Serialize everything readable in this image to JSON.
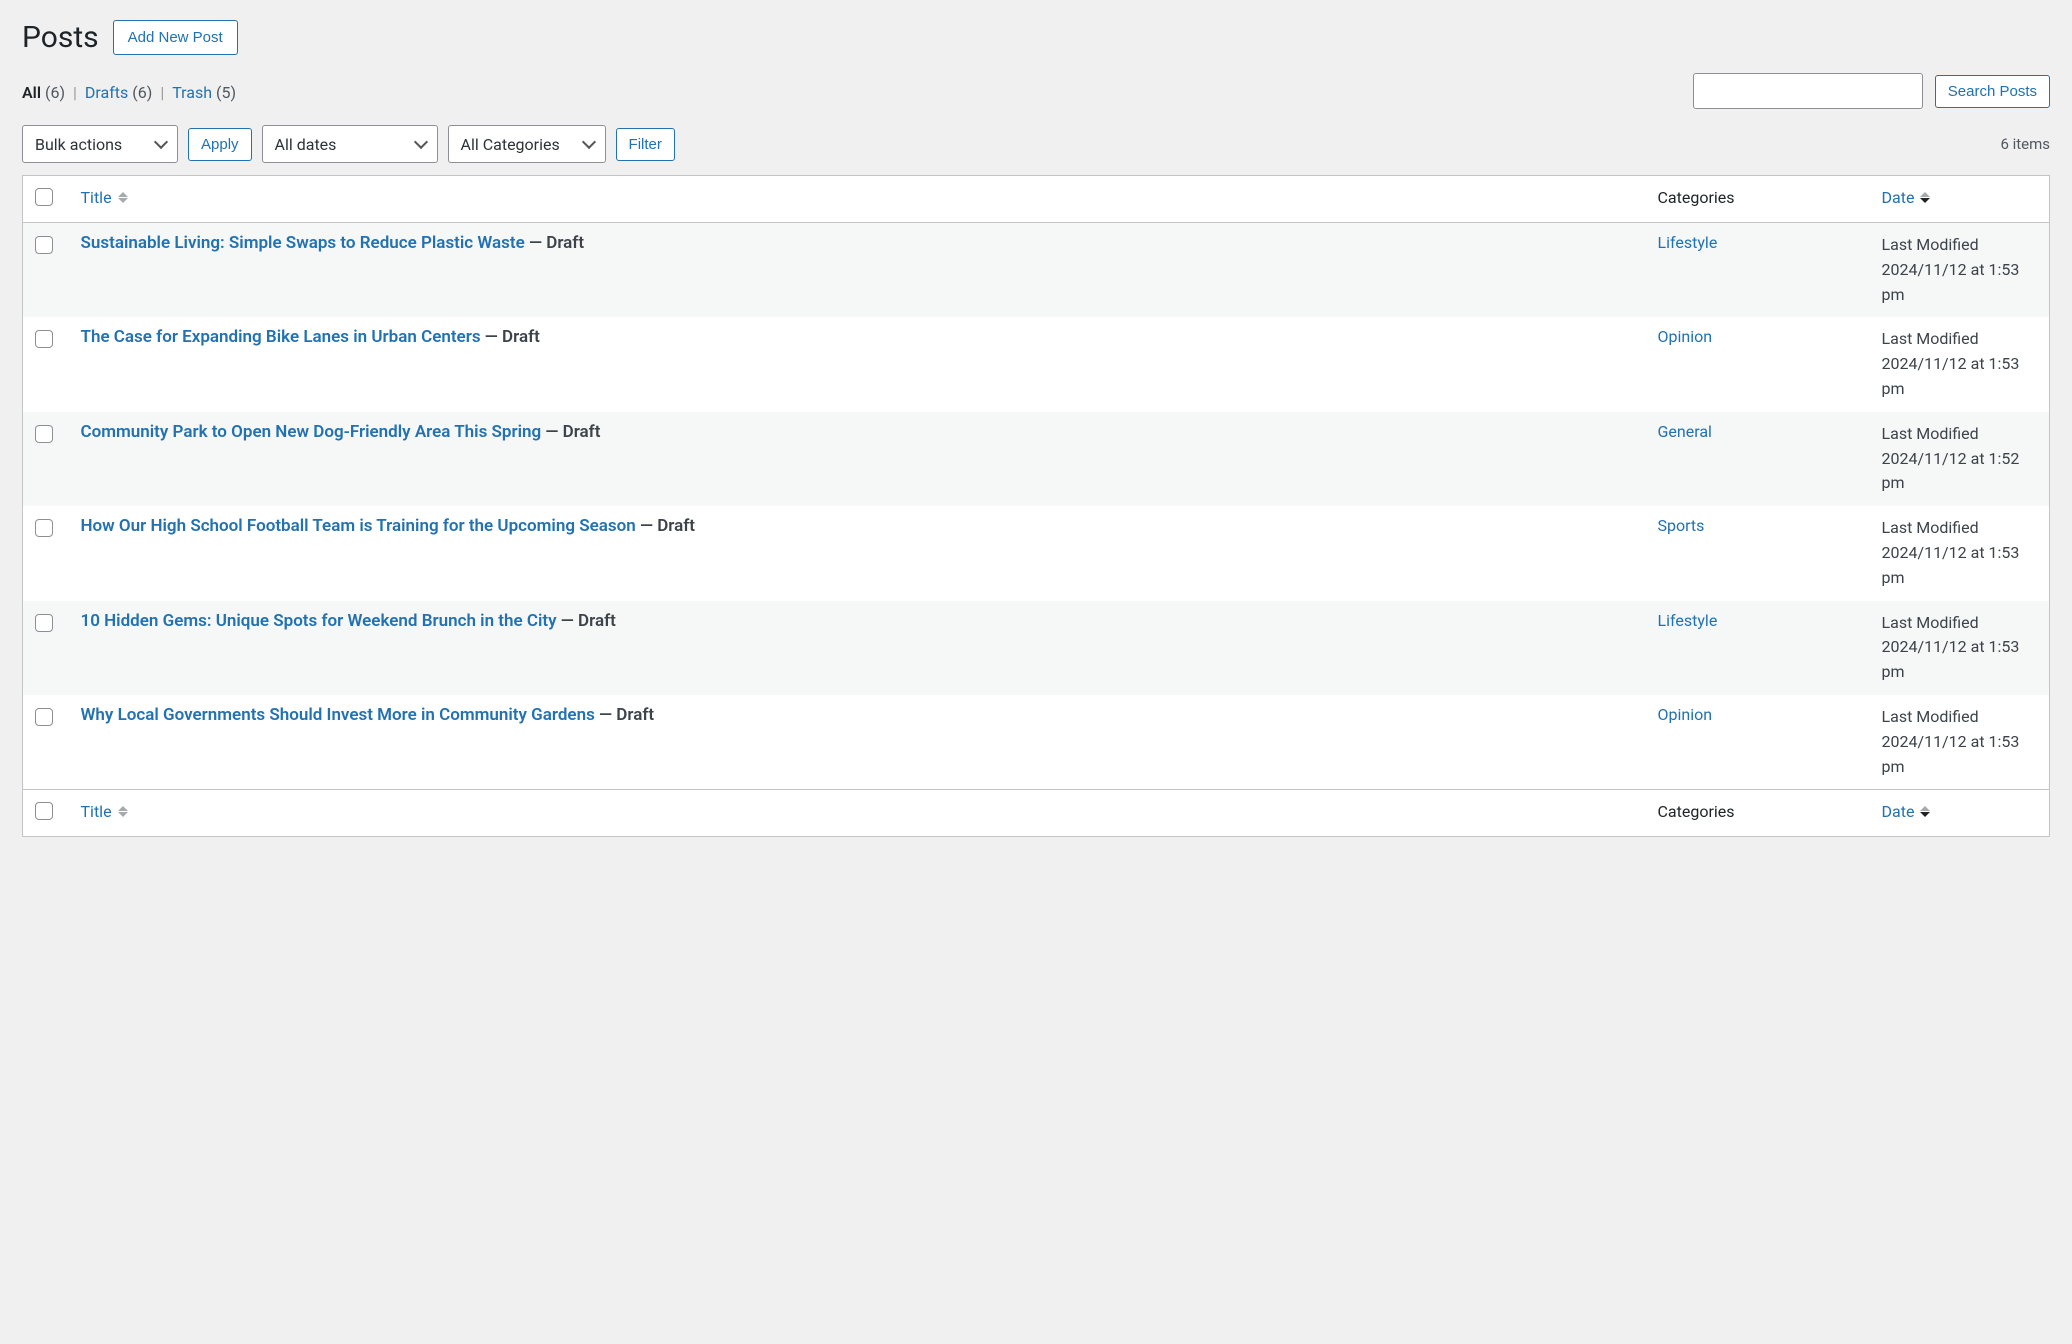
{
  "header": {
    "title": "Posts",
    "add_new_label": "Add New Post"
  },
  "filters_nav": {
    "all_label": "All",
    "all_count": "(6)",
    "drafts_label": "Drafts",
    "drafts_count": "(6)",
    "trash_label": "Trash",
    "trash_count": "(5)"
  },
  "search": {
    "button_label": "Search Posts"
  },
  "toolbar": {
    "bulk_actions_label": "Bulk actions",
    "apply_label": "Apply",
    "all_dates_label": "All dates",
    "all_categories_label": "All Categories",
    "filter_label": "Filter",
    "item_count": "6 items"
  },
  "columns": {
    "title": "Title",
    "categories": "Categories",
    "date": "Date"
  },
  "status_labels": {
    "draft_suffix": " — Draft"
  },
  "posts": [
    {
      "title": "Sustainable Living: Simple Swaps to Reduce Plastic Waste",
      "category": "Lifestyle",
      "date_prefix": "Last Modified",
      "date_line": "2024/11/12 at 1:53 pm"
    },
    {
      "title": "The Case for Expanding Bike Lanes in Urban Centers",
      "category": "Opinion",
      "date_prefix": "Last Modified",
      "date_line": "2024/11/12 at 1:53 pm"
    },
    {
      "title": "Community Park to Open New Dog-Friendly Area This Spring",
      "category": "General",
      "date_prefix": "Last Modified",
      "date_line": "2024/11/12 at 1:52 pm"
    },
    {
      "title": "How Our High School Football Team is Training for the Upcoming Season",
      "category": "Sports",
      "date_prefix": "Last Modified",
      "date_line": "2024/11/12 at 1:53 pm"
    },
    {
      "title": "10 Hidden Gems: Unique Spots for Weekend Brunch in the City",
      "category": "Lifestyle",
      "date_prefix": "Last Modified",
      "date_line": "2024/11/12 at 1:53 pm"
    },
    {
      "title": "Why Local Governments Should Invest More in Community Gardens",
      "category": "Opinion",
      "date_prefix": "Last Modified",
      "date_line": "2024/11/12 at 1:53 pm"
    }
  ]
}
